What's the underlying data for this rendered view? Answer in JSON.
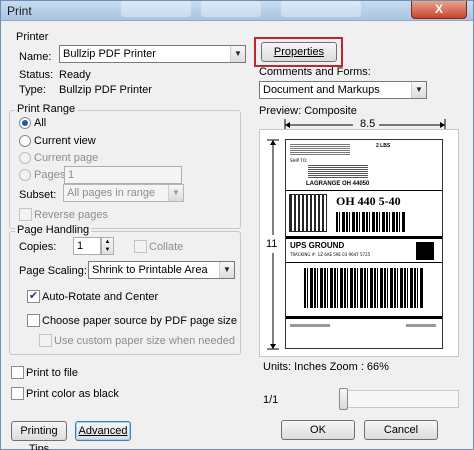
{
  "window": {
    "title": "Print",
    "close_label": "X"
  },
  "printer": {
    "group_label": "Printer",
    "name_label": "Name:",
    "name_value": "Bullzip PDF Printer",
    "status_label": "Status:",
    "status_value": "Ready",
    "type_label": "Type:",
    "type_value": "Bullzip PDF Printer",
    "properties_button": "Properties",
    "comments_label": "Comments and Forms:",
    "comments_value": "Document and Markups"
  },
  "print_range": {
    "group_label": "Print Range",
    "all": "All",
    "current_view": "Current view",
    "current_page": "Current page",
    "pages": "Pages",
    "pages_value": "1",
    "subset_label": "Subset:",
    "subset_value": "All pages in range",
    "reverse_pages": "Reverse pages"
  },
  "page_handling": {
    "group_label": "Page Handling",
    "copies_label": "Copies:",
    "copies_value": "1",
    "collate": "Collate",
    "scaling_label": "Page Scaling:",
    "scaling_value": "Shrink to Printable Area",
    "auto_rotate": "Auto-Rotate and Center",
    "choose_paper": "Choose paper source by PDF page size",
    "custom_paper": "Use custom paper size when needed"
  },
  "options": {
    "print_to_file": "Print to file",
    "print_color_black": "Print color as black"
  },
  "preview": {
    "label": "Preview: Composite",
    "width_label": "8.5",
    "height_label": "11",
    "units_zoom": "Units: Inches Zoom :  66%",
    "page_counter": "1/1",
    "shipping_label": {
      "ship_to": "SHIP TO:",
      "route_code": "OH 440 5-40",
      "service": "UPS GROUND",
      "tracking": "TRACKING #: 1Z 6AE 59E 03 9647 5725",
      "city": "LAGRANGE  OH 44050",
      "weight": "2 LBS"
    }
  },
  "footer": {
    "printing_tips": "Printing Tips",
    "advanced": "Advanced",
    "ok": "OK",
    "cancel": "Cancel"
  },
  "colors": {
    "highlight_box": "#c0272d",
    "accent": "#1f58a8"
  }
}
